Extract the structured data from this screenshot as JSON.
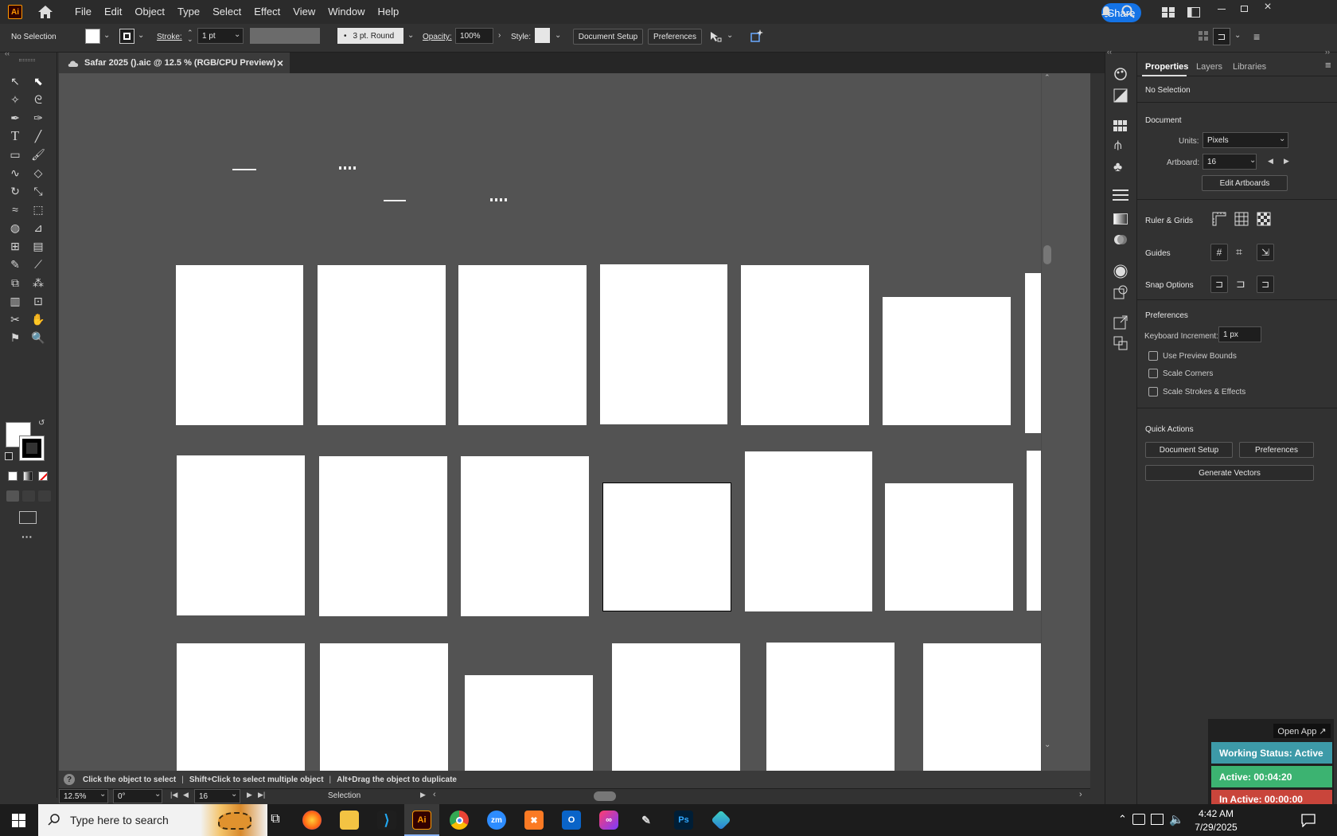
{
  "app": {
    "logo": "Ai",
    "share_label": "Share"
  },
  "menu": [
    "File",
    "Edit",
    "Object",
    "Type",
    "Select",
    "Effect",
    "View",
    "Window",
    "Help"
  ],
  "control": {
    "selection": "No Selection",
    "stroke_label": "Stroke:",
    "stroke_value": "1 pt",
    "brush_value": "3 pt. Round",
    "opacity_label": "Opacity:",
    "opacity_value": "100%",
    "style_label": "Style:",
    "document_setup": "Document Setup",
    "preferences": "Preferences"
  },
  "document_tab": {
    "title": "Safar 2025 ().aic @ 12.5 % (RGB/CPU Preview)",
    "close": "×"
  },
  "status": {
    "hint1": "Click the object to select",
    "hint2": "Shift+Click to select multiple object",
    "hint3": "Alt+Drag the object to duplicate",
    "sep": "|"
  },
  "bottom": {
    "zoom": "12.5%",
    "rotation": "0°",
    "artboard": "16",
    "tool": "Selection"
  },
  "panel": {
    "tabs": [
      "Properties",
      "Layers",
      "Libraries"
    ],
    "selection": "No Selection",
    "document_heading": "Document",
    "units_label": "Units:",
    "units_value": "Pixels",
    "artboard_label": "Artboard:",
    "artboard_value": "16",
    "edit_artboards": "Edit Artboards",
    "ruler_grids": "Ruler & Grids",
    "guides": "Guides",
    "snap_options": "Snap Options",
    "preferences_heading": "Preferences",
    "keyboard_increment_label": "Keyboard Increment:",
    "keyboard_increment_value": "1 px",
    "use_preview_bounds": "Use Preview Bounds",
    "scale_corners": "Scale Corners",
    "scale_strokes": "Scale Strokes & Effects",
    "quick_actions": "Quick Actions",
    "qa_document_setup": "Document Setup",
    "qa_preferences": "Preferences",
    "generate_vectors": "Generate Vectors"
  },
  "widget": {
    "open_app": "Open App ↗",
    "working_status": "Working Status: Active",
    "active": "Active: 00:04:20",
    "inactive": "In Active: 00:00:00"
  },
  "taskbar": {
    "search_placeholder": "Type here to search",
    "time": "4:42 AM",
    "date": "7/29/2025"
  },
  "colors": {
    "accent": "#1473e6",
    "canvas": "#535353",
    "active_green": "#3cb371",
    "teal": "#3d9aa8",
    "inactive_red": "#c9453b"
  }
}
